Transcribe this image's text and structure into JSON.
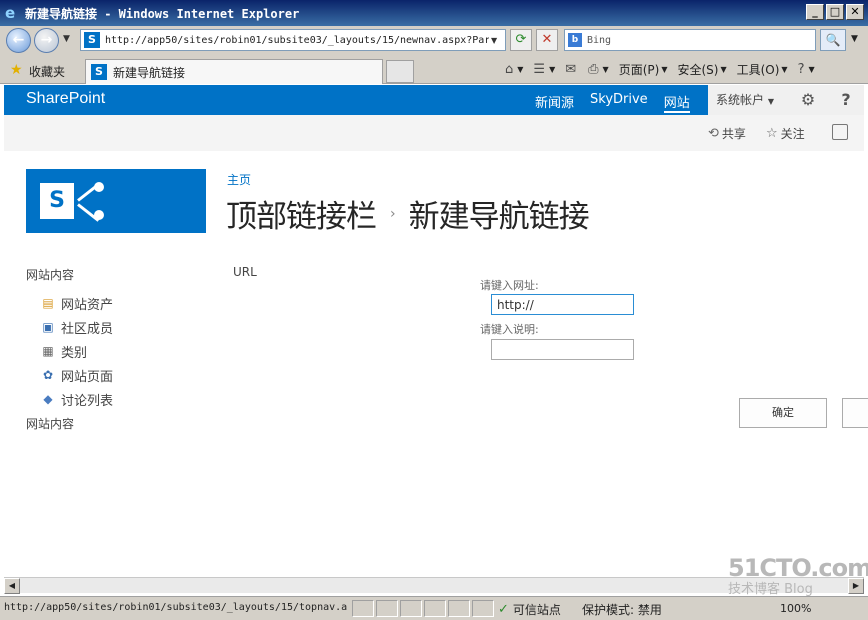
{
  "window": {
    "title": "新建导航链接 - Windows Internet Explorer",
    "address": "http://app50/sites/robin01/subsite03/_layouts/15/newnav.aspx?Par",
    "search_placeholder": "Bing",
    "favorites_label": "收藏夹",
    "tab_label": "新建导航链接",
    "commands": {
      "page": "页面(P)",
      "safety": "安全(S)",
      "tools": "工具(O)"
    },
    "status_url": "http://app50/sites/robin01/subsite03/_layouts/15/topnav.a",
    "trusted_zone": "可信站点",
    "protected_mode": "保护模式: 禁用",
    "zoom": "100%"
  },
  "suitebar": {
    "brand": "SharePoint",
    "links": [
      "新闻源",
      "SkyDrive",
      "网站"
    ],
    "account": "系统帐户"
  },
  "ribbon": {
    "share": "共享",
    "follow": "关注"
  },
  "page": {
    "breadcrumb_home": "主页",
    "title_parent": "顶部链接栏",
    "title_current": "新建导航链接",
    "url_section_label": "URL",
    "address_label": "请键入网址:",
    "address_value": "http://",
    "description_label": "请键入说明:",
    "description_value": "",
    "ok_button": "确定"
  },
  "quicklaunch": {
    "heading": "网站内容",
    "items": [
      "网站资产",
      "社区成员",
      "类别",
      "网站页面",
      "讨论列表"
    ],
    "footer": "网站内容"
  },
  "watermark": {
    "line1": "51CTO.com",
    "line2": "技术博客  Blog"
  },
  "colors": {
    "sharepoint_blue": "#0072c6",
    "title_text": "#262626"
  }
}
